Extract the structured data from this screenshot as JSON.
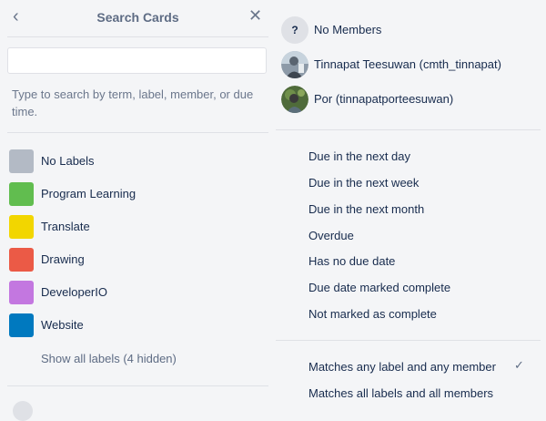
{
  "header": {
    "title": "Search Cards",
    "back_icon": "chevron-left-icon",
    "close_icon": "close-icon"
  },
  "search": {
    "value": "",
    "placeholder": ""
  },
  "hint": "Type to search by term, label, member, or due time.",
  "labels": [
    {
      "name": "No Labels",
      "color": "#b3bac5"
    },
    {
      "name": "Program Learning",
      "color": "#61bd4f"
    },
    {
      "name": "Translate",
      "color": "#f2d600"
    },
    {
      "name": "Drawing",
      "color": "#eb5a46"
    },
    {
      "name": "DeveloperIO",
      "color": "#c377e0"
    },
    {
      "name": "Website",
      "color": "#0079bf"
    }
  ],
  "show_all_labels": "Show all labels (4 hidden)",
  "members": [
    {
      "name": "No Members",
      "avatar": "?"
    },
    {
      "name": "Tinnapat Teesuwan (cmth_tinnapat)"
    },
    {
      "name": "Por (tinnapatporteesuwan)"
    }
  ],
  "due_options": [
    "Due in the next day",
    "Due in the next week",
    "Due in the next month",
    "Overdue",
    "Has no due date",
    "Due date marked complete",
    "Not marked as complete"
  ],
  "match_options": [
    {
      "label": "Matches any label and any member",
      "selected": true
    },
    {
      "label": "Matches all labels and all members",
      "selected": false
    }
  ]
}
